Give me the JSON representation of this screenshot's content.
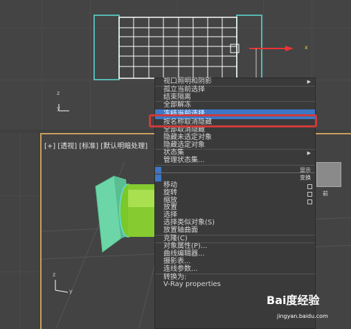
{
  "viewport_persp": {
    "label": "[+] [透视] [标准] [默认明暗处理]"
  },
  "axis": {
    "x": "x",
    "y": "y",
    "z": "z"
  },
  "viewcube": {
    "label": "前"
  },
  "menu": {
    "items": [
      {
        "label": "视口照明和阴影",
        "submenu": true
      },
      {
        "label": "孤立当前选择"
      },
      {
        "label": "结束隔离"
      },
      {
        "label": "全部解冻"
      },
      {
        "label": "冻结当前选择",
        "highlighted": true
      },
      {
        "label": "按名称取消隐藏"
      },
      {
        "label": "全部取消隐藏"
      },
      {
        "label": "隐藏未选定对象"
      },
      {
        "label": "隐藏选定对象"
      },
      {
        "label": "状态集",
        "submenu": true
      },
      {
        "label": "管理状态集..."
      }
    ],
    "quad_labels": [
      "显示",
      "变换"
    ],
    "transform_items": [
      "移动",
      "旋转",
      "缩放",
      "放置",
      "选择",
      "选择类似对象(S)",
      "放置轴曲面",
      "克隆(C)",
      "对象属性(P)...",
      "曲线编辑器...",
      "摄影表...",
      "连线参数...",
      "转换为:",
      "V-Ray properties"
    ]
  },
  "watermark": {
    "brand": "Bai度经验",
    "url": "jingyan.baidu.com"
  }
}
